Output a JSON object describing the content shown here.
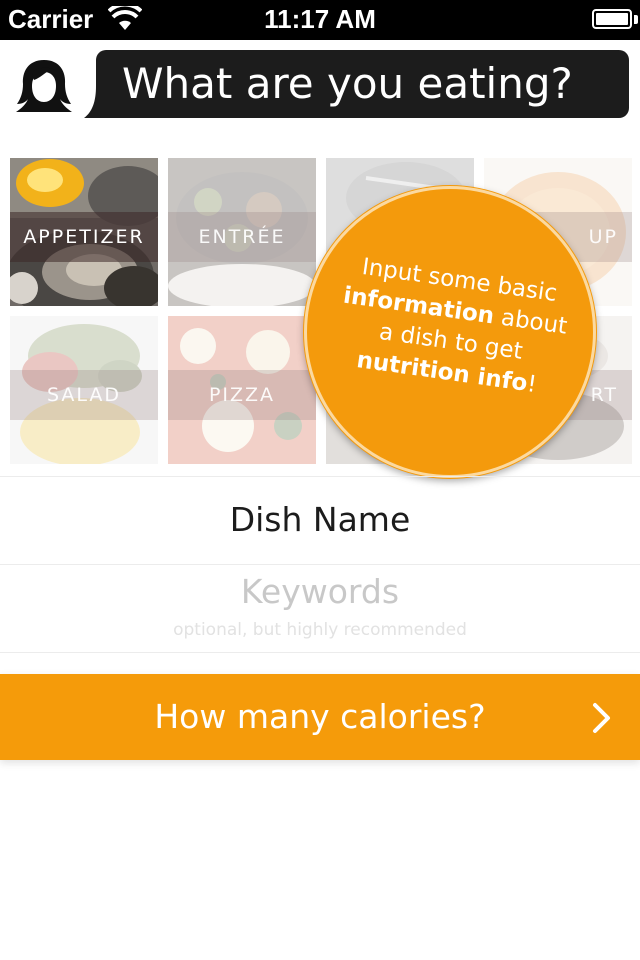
{
  "status_bar": {
    "carrier": "Carrier",
    "time": "11:17 AM"
  },
  "header": {
    "question": "What are you eating?",
    "avatar_icon": "woman-silhouette-icon"
  },
  "categories": [
    {
      "label": "APPETIZER",
      "selected": true
    },
    {
      "label": "ENTRÉE",
      "selected": false
    },
    {
      "label": "SOUP",
      "visible_text": "UP",
      "selected": false
    },
    {
      "label": "SALAD",
      "selected": false
    },
    {
      "label": "PIZZA",
      "selected": false
    },
    {
      "label": "DESSERT",
      "visible_text": "RT",
      "selected": false
    }
  ],
  "tooltip": {
    "line1": "Input some basic",
    "line2_bold": "information",
    "line2_rest": " about",
    "line3": "a dish to get",
    "line4_bold": "nutrition info",
    "line4_rest": "!"
  },
  "form": {
    "dish_name_placeholder": "Dish Name",
    "keywords_placeholder": "Keywords",
    "keywords_hint": "optional, but highly recommended"
  },
  "cta": {
    "label": "How many calories?"
  },
  "colors": {
    "accent": "#f59b0a",
    "header_bubble": "#1c1c1c"
  }
}
